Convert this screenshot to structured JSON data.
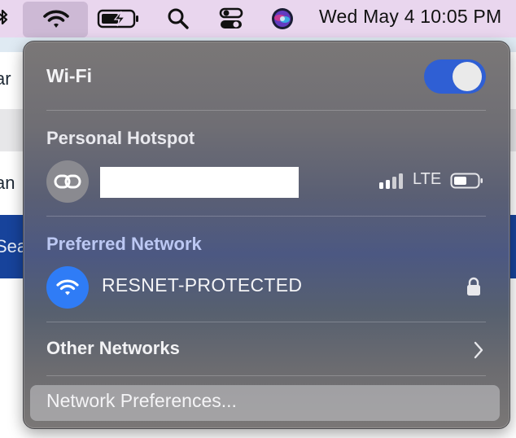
{
  "menubar": {
    "datetime": "Wed May 4  10:05 PM",
    "icons": [
      "bluetooth-icon",
      "wifi-icon",
      "battery-charging-icon",
      "search-icon",
      "control-center-icon",
      "siri-icon"
    ]
  },
  "background": {
    "fragments": [
      "ar",
      "an",
      "Sea"
    ]
  },
  "wifi": {
    "title": "Wi-Fi",
    "enabled": true
  },
  "hotspot": {
    "header": "Personal Hotspot",
    "device_name": "",
    "signal_bars": 4,
    "network_type": "LTE",
    "battery_level": 0.5
  },
  "preferred": {
    "header": "Preferred Network",
    "network_name": "RESNET-PROTECTED",
    "secured": true
  },
  "other": {
    "label": "Other Networks"
  },
  "footer": {
    "prefs_label": "Network Preferences..."
  },
  "colors": {
    "menubar_bg": "#e9d6ee",
    "toggle_on": "#2f5fd4",
    "wifi_circle": "#2f7cf6",
    "preferred_header": "#bcc8f3"
  }
}
